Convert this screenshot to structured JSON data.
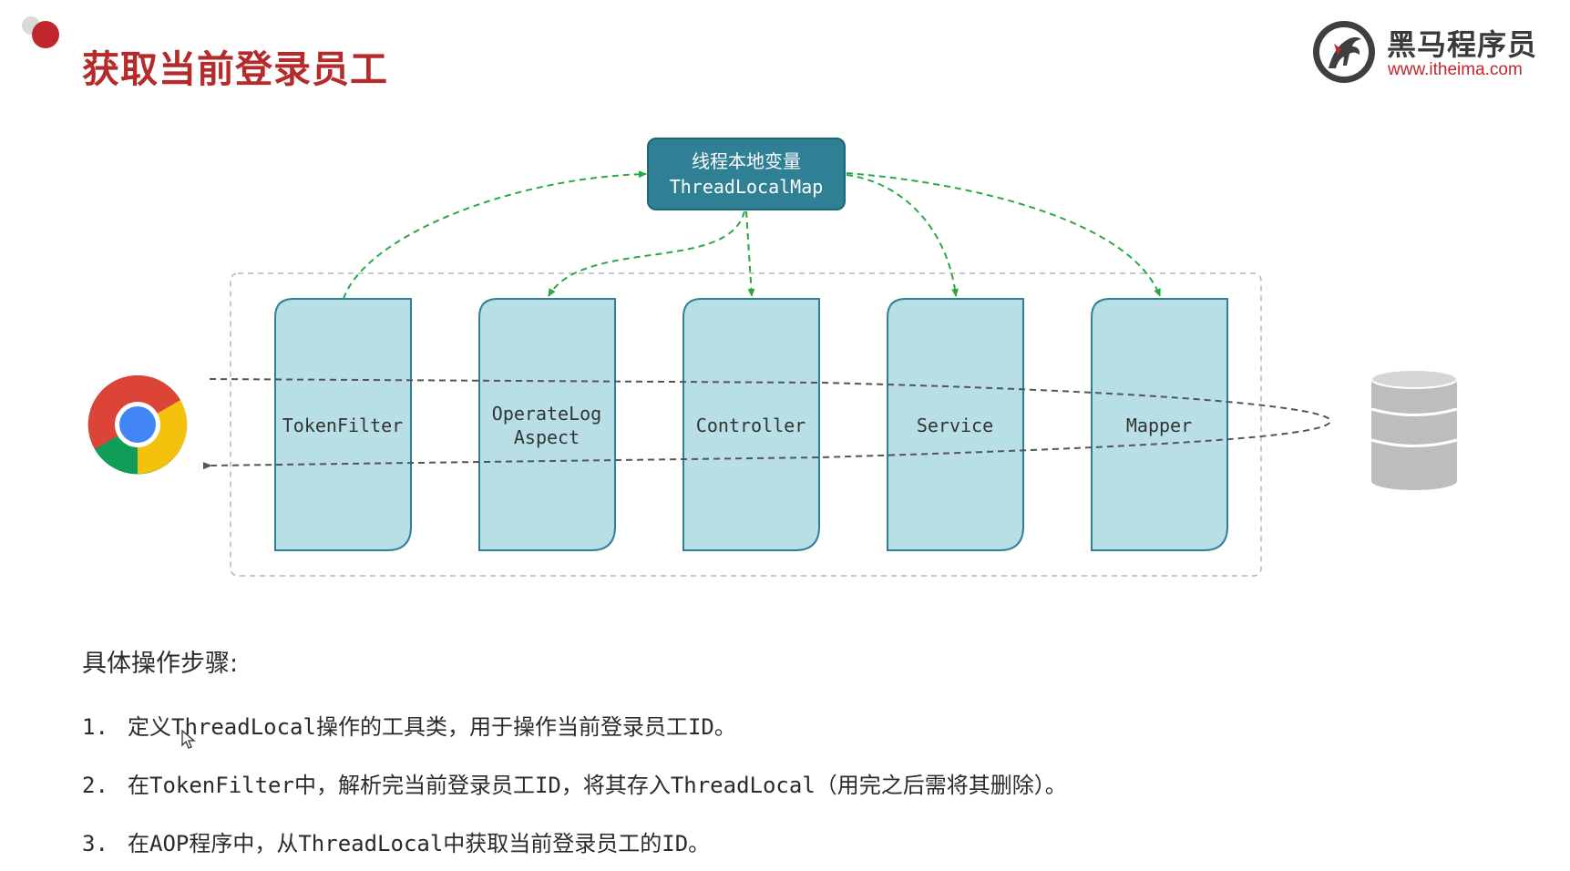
{
  "header": {
    "title": "获取当前登录员工"
  },
  "logo": {
    "name": "黑马程序员",
    "url": "www.itheima.com"
  },
  "diagram": {
    "thread_local_box": {
      "line1": "线程本地变量",
      "line2": "ThreadLocalMap"
    },
    "components": [
      {
        "label": "TokenFilter"
      },
      {
        "label_line1": "OperateLog",
        "label_line2": "Aspect"
      },
      {
        "label": "Controller"
      },
      {
        "label": "Service"
      },
      {
        "label": "Mapper"
      }
    ],
    "client_icon": "chrome-browser-icon",
    "database_icon": "database-icon"
  },
  "steps": {
    "heading": "具体操作步骤:",
    "items": [
      {
        "num": "1.",
        "text": "定义ThreadLocal操作的工具类，用于操作当前登录员工ID。"
      },
      {
        "num": "2.",
        "text": "在TokenFilter中，解析完当前登录员工ID，将其存入ThreadLocal（用完之后需将其删除）。"
      },
      {
        "num": "3.",
        "text": "在AOP程序中，从ThreadLocal中获取当前登录员工的ID。"
      }
    ]
  },
  "colors": {
    "title_red": "#b52a2a",
    "box_fill": "#b8dfe6",
    "box_stroke": "#2f7f95",
    "top_box_fill": "#2f7f95",
    "arrow_green": "#2aa845",
    "request_line": "#555555"
  }
}
